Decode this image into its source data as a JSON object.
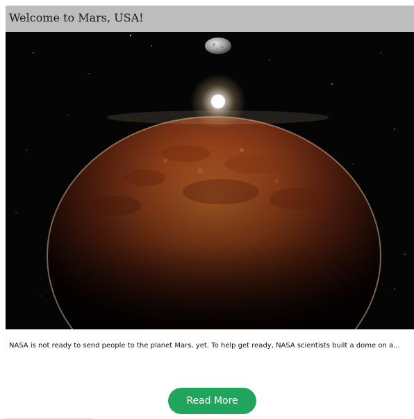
{
  "post": {
    "title": "Welcome to Mars, USA!",
    "image": {
      "subject": "Mars planet in space",
      "icons": [
        "moon-icon",
        "sun-glow-icon",
        "mars-planet-icon"
      ]
    },
    "excerpt": "NASA is not ready to send people to the planet Mars, yet. To help get ready, NASA scientists built a dome on a...",
    "button_label": "Read More"
  },
  "colors": {
    "title_bar": "#bdbdbd",
    "button": "#21a45c",
    "button_text": "#ffffff",
    "space_bg": "#050505"
  }
}
